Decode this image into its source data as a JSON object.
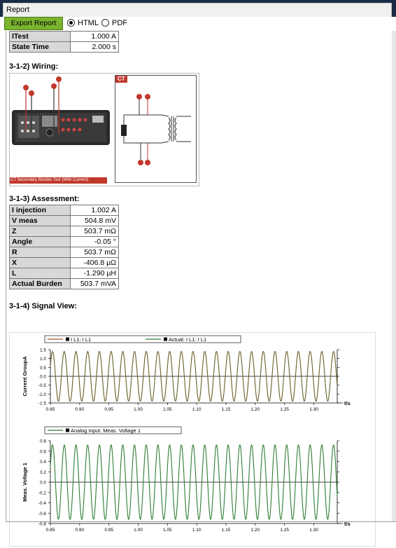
{
  "window": {
    "tab_title": "Report"
  },
  "toolbar": {
    "export_label": "Export Report",
    "format_options": [
      {
        "label": "HTML",
        "selected": true
      },
      {
        "label": "PDF",
        "selected": false
      }
    ]
  },
  "top_table": [
    {
      "key": "ITest",
      "value": "1.000 A"
    },
    {
      "key": "State Time",
      "value": "2.000 s"
    }
  ],
  "wiring": {
    "title": "3-1-2) Wiring:",
    "caption": "CT Secondary Burden Test (With Current)",
    "ct_label": "CT"
  },
  "assessment": {
    "title": "3-1-3) Assessment:",
    "rows": [
      {
        "key": "I injection",
        "value": "1.002 A"
      },
      {
        "key": "V meas",
        "value": "504.8 mV"
      },
      {
        "key": "Z",
        "value": "503.7 mΩ"
      },
      {
        "key": "Angle",
        "value": "-0.05 °"
      },
      {
        "key": "R",
        "value": "503.7 mΩ"
      },
      {
        "key": "X",
        "value": "-406.8 µΩ"
      },
      {
        "key": "L",
        "value": "-1.290 µH"
      },
      {
        "key": "Actual Burden",
        "value": "503.7 mVA"
      }
    ]
  },
  "signal_view": {
    "title": "3-1-4) Signal View:"
  },
  "chart_data": [
    {
      "type": "line",
      "legend": [
        "I L1: I L1",
        "Actual: I L1: I L1"
      ],
      "ylabel": "Current GroupA",
      "xlabel": "t/s",
      "xlim": [
        0.85,
        1.34
      ],
      "ylim": [
        -1.5,
        1.5
      ],
      "x_ticks": [
        "0.85",
        "0.90",
        "0.95",
        "1.00",
        "1.05",
        "1.10",
        "1.15",
        "1.20",
        "1.25",
        "1.30"
      ],
      "y_ticks": [
        "1.5",
        "1.0",
        "0.5",
        "0.0",
        "-0.5",
        "-1.0",
        "-1.5"
      ],
      "series": [
        {
          "name": "I L1: I L1",
          "color": "#a0522d",
          "amplitude": 1.4,
          "frequency_hz": 50
        },
        {
          "name": "Actual: I L1: I L1",
          "color": "#2e7d32",
          "amplitude": 1.4,
          "frequency_hz": 50
        }
      ]
    },
    {
      "type": "line",
      "legend": [
        "Analog Input: Meas. Voltage 1"
      ],
      "ylabel": "Meas. Voltage 1",
      "xlabel": "t/s",
      "xlim": [
        0.85,
        1.34
      ],
      "ylim": [
        -0.8,
        0.8
      ],
      "x_ticks": [
        "0.85",
        "0.90",
        "0.95",
        "1.00",
        "1.05",
        "1.10",
        "1.15",
        "1.20",
        "1.25",
        "1.30"
      ],
      "y_ticks": [
        "0.8",
        "0.6",
        "0.4",
        "0.2",
        "0.0",
        "-0.2",
        "-0.4",
        "-0.6",
        "-0.8"
      ],
      "series": [
        {
          "name": "Analog Input: Meas. Voltage 1",
          "color": "#2e7d32",
          "amplitude": 0.72,
          "frequency_hz": 50
        }
      ]
    }
  ]
}
